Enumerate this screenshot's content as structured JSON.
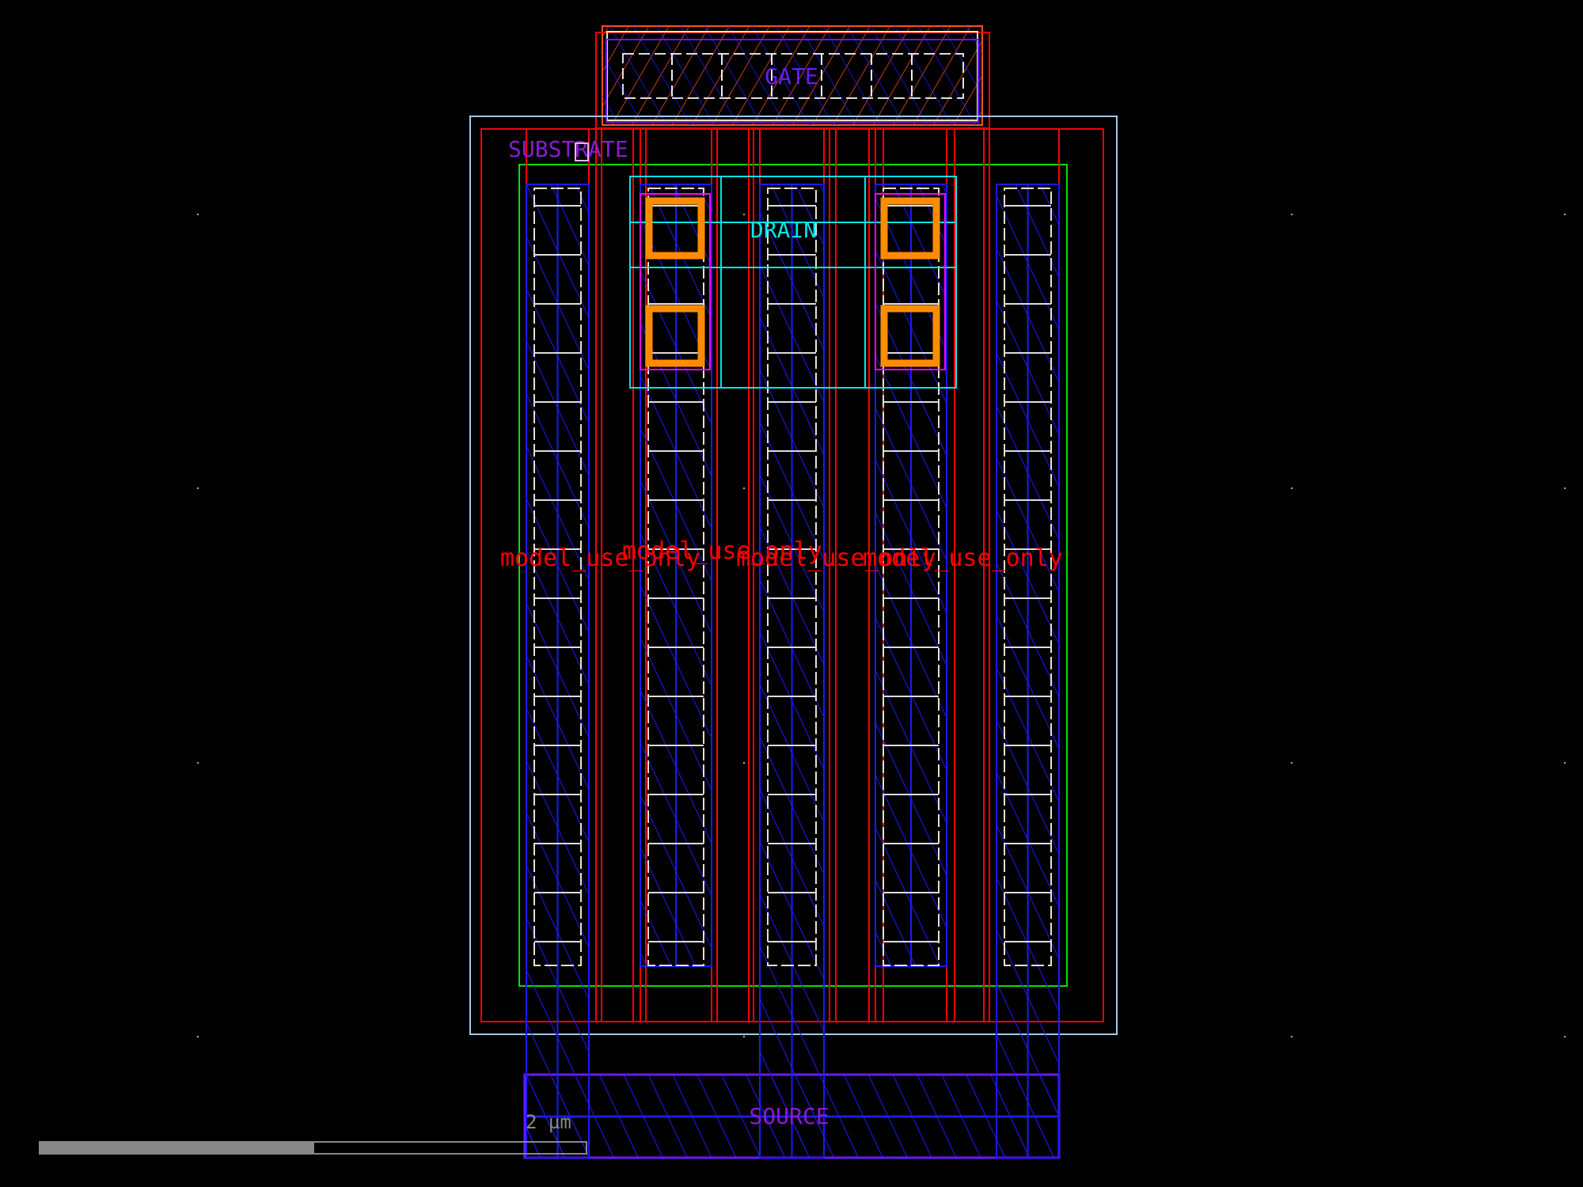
{
  "labels": {
    "gate": "GATE",
    "substrate": "SUBSTRATE",
    "drain": "DRAIN",
    "source": "SOURCE",
    "model_use_only": "model_use_only",
    "scale": "2 µm"
  },
  "colors": {
    "background": "#000000",
    "nwell": "#9ec9ee",
    "boundary": "#ff0000",
    "diffusion": "#00e000",
    "metal": "#1a1aff",
    "poly": "#ff6030",
    "contact": "#ff8c00",
    "drain_metal": "#00e5e5",
    "pin_label": "#8a1ad8",
    "scale_bar": "#888888"
  }
}
